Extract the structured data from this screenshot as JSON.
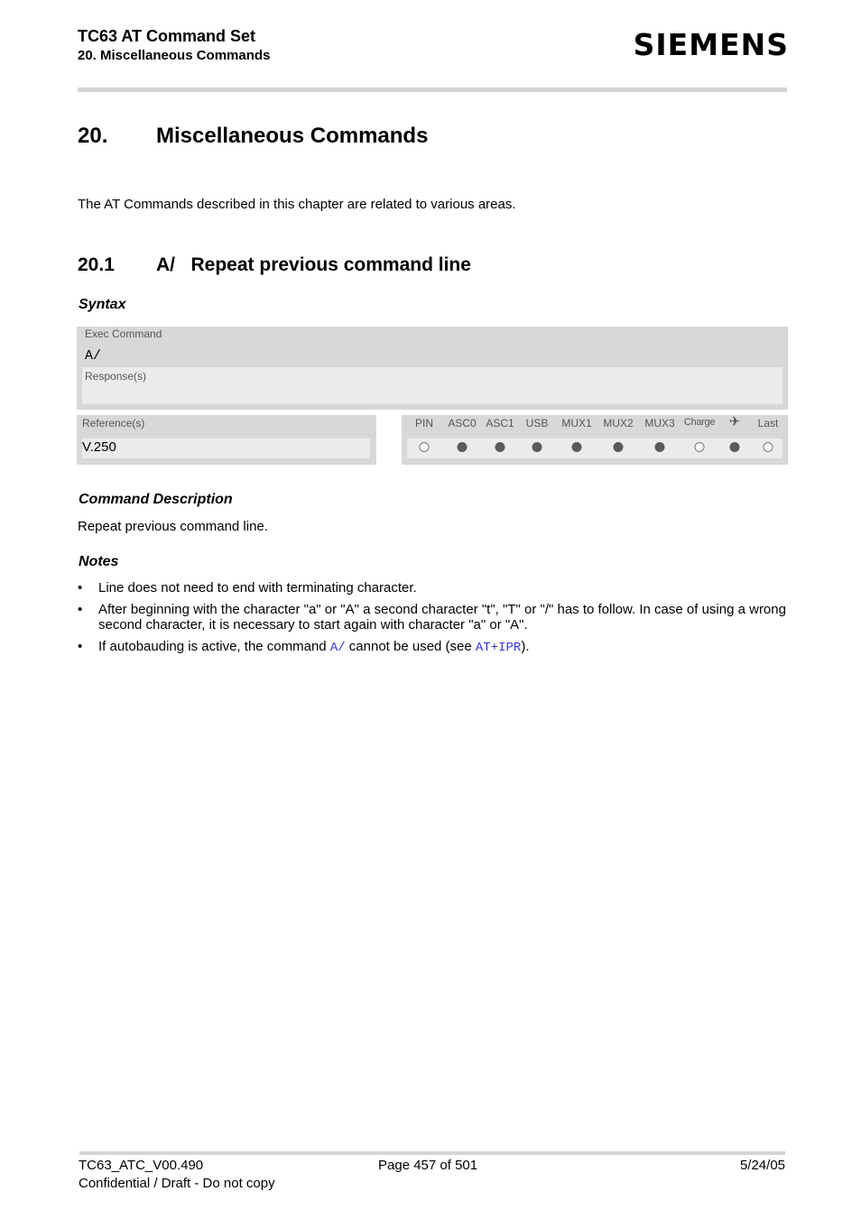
{
  "header": {
    "title": "TC63 AT Command Set",
    "subtitle": "20. Miscellaneous Commands",
    "logo": "SIEMENS"
  },
  "chapter": {
    "number": "20.",
    "title": "Miscellaneous Commands",
    "intro": "The AT Commands described in this chapter are related to various areas."
  },
  "section": {
    "number": "20.1",
    "title": "A/   Repeat previous command line"
  },
  "syntax": {
    "heading": "Syntax",
    "exec_label": "Exec Command",
    "exec_value": "A/",
    "response_label": "Response(s)",
    "response_value": "",
    "reference_label": "Reference(s)",
    "reference_value": "V.250",
    "flags": [
      {
        "label": "PIN",
        "state": "off"
      },
      {
        "label": "ASC0",
        "state": "on"
      },
      {
        "label": "ASC1",
        "state": "on"
      },
      {
        "label": "USB",
        "state": "on"
      },
      {
        "label": "MUX1",
        "state": "on"
      },
      {
        "label": "MUX2",
        "state": "on"
      },
      {
        "label": "MUX3",
        "state": "on"
      },
      {
        "label": "Charge",
        "state": "off"
      },
      {
        "label": "✈",
        "icon": "airplane-icon",
        "state": "on"
      },
      {
        "label": "Last",
        "state": "off"
      }
    ]
  },
  "description": {
    "heading": "Command Description",
    "text": "Repeat previous command line."
  },
  "notes": {
    "heading": "Notes",
    "bullet": "•",
    "items": [
      {
        "text": "Line does not need to end with terminating character."
      },
      {
        "text": "After beginning with the character \"a\" or \"A\" a second character \"t\", \"T\" or \"/\" has to follow. In case of using a wrong second character, it is necessary to start again with character \"a\" or \"A\"."
      },
      {
        "pre": "If autobauding is active, the command ",
        "link1": "A/",
        "mid": " cannot be used (see ",
        "link2": "AT+IPR",
        "post": ")."
      }
    ]
  },
  "footer": {
    "doc_id": "TC63_ATC_V00.490",
    "page": "Page 457 of 501",
    "date": "5/24/05",
    "confidential": "Confidential / Draft - Do not copy"
  },
  "colors": {
    "link": "#3333dd",
    "box_dark": "#d8d8d8",
    "box_light": "#ebebeb",
    "dot_on": "#5a5a5a"
  }
}
